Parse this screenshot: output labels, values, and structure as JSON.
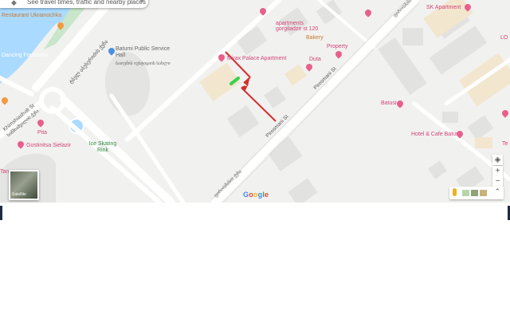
{
  "search": {
    "text": "See travel times, traffic and nearby places",
    "icon": "directions-icon"
  },
  "pois": {
    "restaurant_ukrainochka": "Restaurant Ukrainochka",
    "dancing_fountains": "Dancing Fountains",
    "public_service_hall": "Batumi Public Service Hall",
    "public_service_hall_ka": "ბათუმის იუსტიციის სახლი",
    "apartments": "apartments",
    "apartments_sub": "gorgiladze st 120",
    "bakery": "Bakery",
    "property": "Property",
    "duta": "Duta",
    "mirax_palace": "Mirax Palace Apartment",
    "sk_apartment": "SK Apartment",
    "batusi": "Batusi",
    "hotel_cafe_batusi": "Hotel & Cafe Batusi",
    "pita": "Pita",
    "gostinitsa_sielazir": "Gostinitsa Sielazir",
    "ice_skating_rink": "Ice Skating Rink",
    "lo_partial": "LO",
    "te_partial": "Te",
    "tan_partial": "Tan"
  },
  "streets": {
    "tbel": "ტბელ აბუსერიძის ქუჩა",
    "khimshiashvili": "Khimshiashvili St",
    "khimshiashvili_ka": "ხიმშიაშვილის ქუჩა",
    "pirosmani": "Pirosmani St",
    "pirosmani_ka": "ფიროსმანის ქუჩა"
  },
  "controls": {
    "compass": "◈",
    "zoom_in": "+",
    "zoom_out": "−",
    "expand": "⌃"
  },
  "thumbnail": {
    "label": "Satellite"
  },
  "google_logo": [
    "G",
    "o",
    "o",
    "g",
    "l",
    "e"
  ],
  "colors": {
    "map_bg": "#f1f1ef",
    "water": "#aadaff",
    "road": "#ffffff",
    "park": "#c8e6c9",
    "poi_pink": "#e85f8d",
    "annotation_red": "#d32f2f",
    "marker_green": "#3bd14a",
    "google_blue": "#4285F4",
    "google_red": "#EA4335",
    "google_yellow": "#FBBC05",
    "google_green": "#34A853"
  }
}
